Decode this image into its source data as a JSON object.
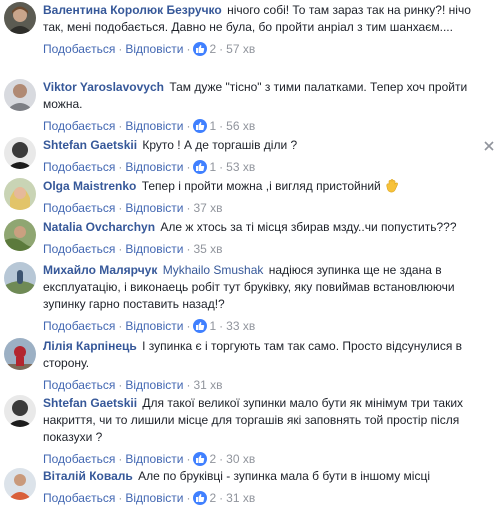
{
  "labels": {
    "like": "Подобається",
    "reply": "Відповісти",
    "dot": "·"
  },
  "comments": [
    {
      "author": "Валентина Королюк Безручко",
      "mention": "",
      "text": "нічого собі! То там зараз так на ринку?! нічо так, мені подобається. Давно не була, бо пройти анріал з тим шанхаєм....",
      "likes": "2",
      "time": "57 хв"
    },
    {
      "author": "Viktor Yaroslavovych",
      "mention": "",
      "text": "Там дуже \"тісно\" з тими палатками. Тепер хоч пройти можна.",
      "likes": "1",
      "time": "56 хв"
    },
    {
      "author": "Shtefan Gaetskii",
      "mention": "",
      "text": "Круто ! А де торгашів діли ?",
      "likes": "1",
      "time": "53 хв"
    },
    {
      "author": "Olga Maistrenko",
      "mention": "",
      "text": "Тепер і пройти можна ,і вигляд пристойний",
      "likes": "",
      "time": "37 хв"
    },
    {
      "author": "Natalia Ovcharchyn",
      "mention": "",
      "text": "Але ж хтось за ті місця збирав мзду..чи попустить???",
      "likes": "",
      "time": "35 хв"
    },
    {
      "author": "Михайло Малярчук",
      "mention": "Mykhailo Smushak",
      "text": "надіюся зупинка ще не здана в експлуатацію, і виконаець робіт тут бруківку, яку повиймав встановлюючи зупинку гарно поставить назад!?",
      "likes": "1",
      "time": "33 хв"
    },
    {
      "author": "Лілія Карпінець",
      "mention": "",
      "text": "І зупинка є і торгують там так само. Просто відсунулися в сторону.",
      "likes": "",
      "time": "31 хв"
    },
    {
      "author": "Shtefan Gaetskii",
      "mention": "",
      "text": "Для такої великої зупинки мало бути як мінімум три таких накриття, чи то лишили місце для торгашів які заповнять той простір після показухи ?",
      "likes": "2",
      "time": "30 хв"
    },
    {
      "author": "Віталій Коваль",
      "mention": "",
      "text": "Але по бруківці - зупинка мала б бути в іншому місці",
      "likes": "2",
      "time": "31 хв"
    }
  ],
  "colors": {
    "link": "#365899",
    "meta": "#90949c",
    "like_badge": "#4080ff"
  },
  "icons": {
    "like": "thumbs-up-icon",
    "close": "close-icon",
    "emoji": "waving-hand-emoji"
  }
}
